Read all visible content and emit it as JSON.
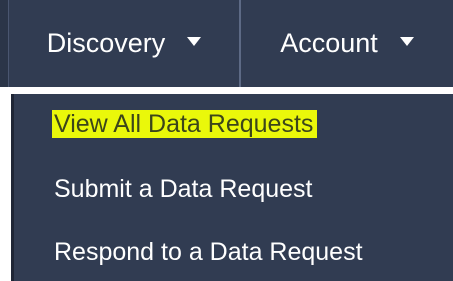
{
  "nav": {
    "items": [
      {
        "label": "Discovery"
      },
      {
        "label": "Account"
      }
    ]
  },
  "dropdown": {
    "items": [
      {
        "label": "View All Data Requests",
        "highlighted": true
      },
      {
        "label": "Submit a Data Request"
      },
      {
        "label": "Respond to a Data Request"
      }
    ]
  },
  "colors": {
    "navbar_bg": "#313c52",
    "highlight": "#eaf80a",
    "text": "#ffffff"
  },
  "icons": [
    "caret-down-icon",
    "caret-down-icon"
  ]
}
